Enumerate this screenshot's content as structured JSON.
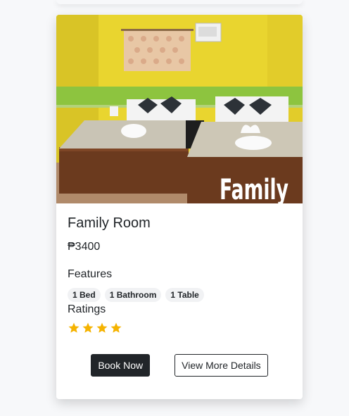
{
  "room": {
    "title": "Family Room",
    "price": "₱3400",
    "photo_caption": "Family",
    "features_label": "Features",
    "features": [
      "1 Bed",
      "1 Bathroom",
      "1 Table"
    ],
    "ratings_label": "Ratings",
    "rating": 4,
    "star_color": "#f5b301"
  },
  "actions": {
    "book_label": "Book Now",
    "details_label": "View More Details"
  }
}
